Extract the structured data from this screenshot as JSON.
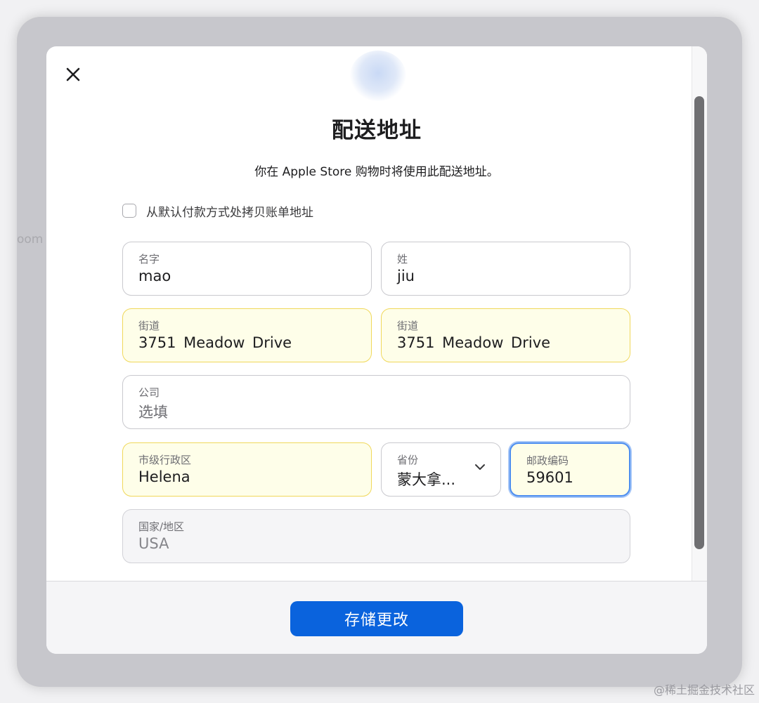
{
  "background": {
    "fragment_text": "oom"
  },
  "dialog": {
    "title": "配送地址",
    "subtitle": "你在 Apple Store 购物时将使用此配送地址。",
    "copy_billing": {
      "label": "从默认付款方式处拷贝账单地址",
      "checked": false
    },
    "fields": {
      "first_name": {
        "label": "名字",
        "value": "mao"
      },
      "last_name": {
        "label": "姓",
        "value": "jiu"
      },
      "street1": {
        "label": "街道",
        "value": "3751 Meadow Drive",
        "state": "autofilled"
      },
      "street2": {
        "label": "街道",
        "value": "3751 Meadow Drive",
        "state": "autofilled"
      },
      "company": {
        "label": "公司",
        "placeholder": "选填"
      },
      "city": {
        "label": "市级行政区",
        "value": "Helena",
        "state": "autofilled"
      },
      "province": {
        "label": "省份",
        "value": "蒙大拿..."
      },
      "postal_code": {
        "label": "邮政编码",
        "value": "59601",
        "state": "focused"
      },
      "country": {
        "label": "国家/地区",
        "value": "USA",
        "state": "disabled"
      }
    },
    "save_button": "存储更改"
  },
  "watermark": "@稀土掘金技术社区",
  "colors": {
    "primary_button": "#0a63dd",
    "autofill_background": "#fefee9",
    "autofill_border": "#f0d85a",
    "focus_ring": "#4d8ef0"
  },
  "icons": {
    "close": "close-icon",
    "dropdown": "chevron-down-icon",
    "header": "header-icon"
  }
}
